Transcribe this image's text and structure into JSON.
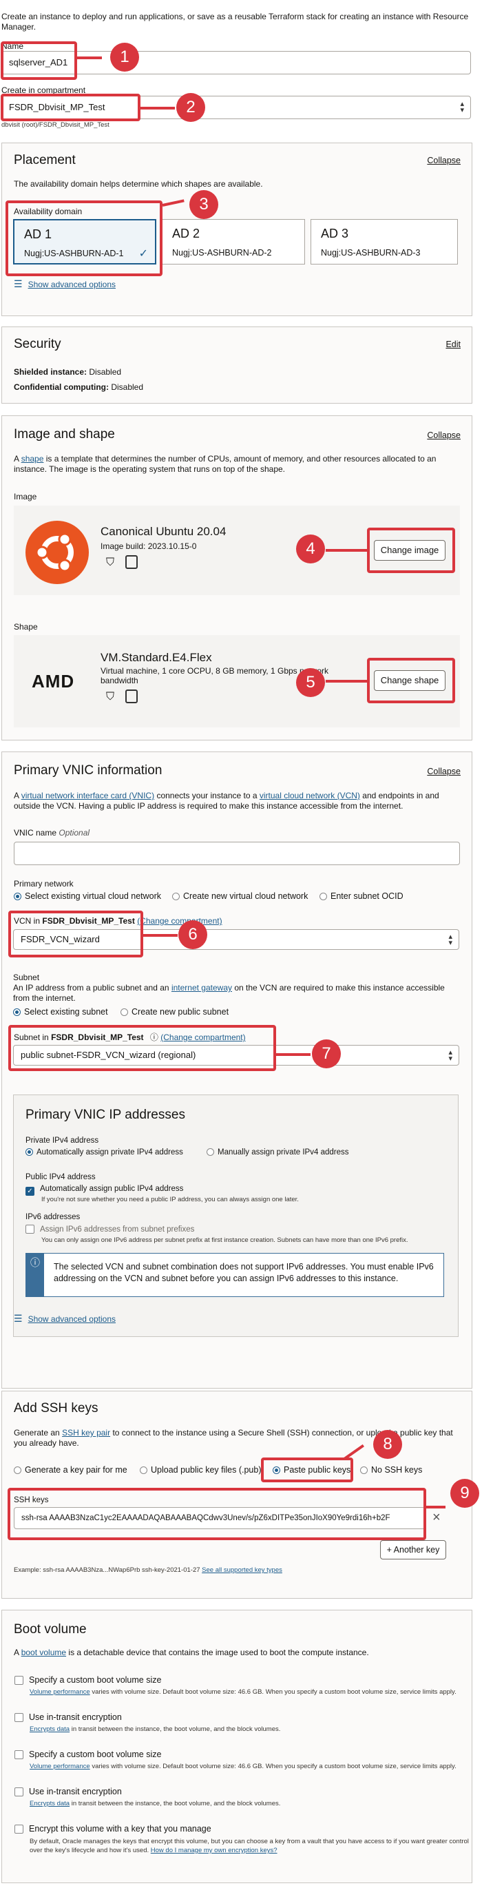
{
  "intro": "Create an instance to deploy and run applications, or save as a reusable Terraform stack for creating an instance with Resource Manager.",
  "name_field": {
    "label": "Name",
    "value": "sqlserver_AD1"
  },
  "compartment": {
    "label": "Create in compartment",
    "value": "FSDR_Dbvisit_MP_Test",
    "path": "dbvisit (root)/FSDR_Dbvisit_MP_Test"
  },
  "placement": {
    "title": "Placement",
    "collapse": "Collapse",
    "help": "The availability domain helps determine which shapes are available.",
    "ad_label": "Availability domain",
    "ads": [
      {
        "name": "AD 1",
        "sub": "Nugj:US-ASHBURN-AD-1"
      },
      {
        "name": "AD 2",
        "sub": "Nugj:US-ASHBURN-AD-2"
      },
      {
        "name": "AD 3",
        "sub": "Nugj:US-ASHBURN-AD-3"
      }
    ],
    "advanced": "Show advanced options"
  },
  "security": {
    "title": "Security",
    "edit": "Edit",
    "shielded_label": "Shielded instance:",
    "shielded_value": "Disabled",
    "confidential_label": "Confidential computing:",
    "confidential_value": "Disabled"
  },
  "image_shape": {
    "title": "Image and shape",
    "collapse": "Collapse",
    "desc_pre": "A",
    "desc_link": "shape",
    "desc_post": "is a template that determines the number of CPUs, amount of memory, and other resources allocated to an instance. The image is the operating system that runs on top of the shape.",
    "image_label": "Image",
    "image_name": "Canonical Ubuntu 20.04",
    "image_build": "Image build: 2023.10.15-0",
    "change_image": "Change image",
    "shape_label": "Shape",
    "shape_name": "VM.Standard.E4.Flex",
    "shape_desc": "Virtual machine, 1 core OCPU, 8 GB memory, 1 Gbps network bandwidth",
    "amd_logo": "AMD",
    "change_shape": "Change shape"
  },
  "vnic": {
    "title": "Primary VNIC information",
    "collapse": "Collapse",
    "desc_1": "A",
    "desc_link1": "virtual network interface card (VNIC)",
    "desc_2": "connects your instance to a",
    "desc_link2": "virtual cloud network (VCN)",
    "desc_3": "and endpoints in and outside the VCN. Having a public IP address is required to make this instance accessible from the internet.",
    "vnic_name_label": "VNIC name",
    "optional": "Optional",
    "network_label": "Primary network",
    "network_options": [
      "Select existing virtual cloud network",
      "Create new virtual cloud network",
      "Enter subnet OCID"
    ],
    "vcn_label_pre": "VCN in",
    "vcn_label_bold": "FSDR_Dbvisit_MP_Test",
    "change_compartment": "(Change compartment)",
    "vcn_value": "FSDR_VCN_wizard",
    "subnet_title": "Subnet",
    "subnet_desc_1": "An IP address from a public subnet and an",
    "subnet_desc_link": "internet gateway",
    "subnet_desc_2": "on the VCN are required to make this instance accessible from the internet.",
    "subnet_options": [
      "Select existing subnet",
      "Create new public subnet"
    ],
    "subnet_label_pre": "Subnet in",
    "subnet_label_bold": "FSDR_Dbvisit_MP_Test",
    "subnet_change": "(Change compartment)",
    "subnet_value": "public subnet-FSDR_VCN_wizard (regional)"
  },
  "ip": {
    "title": "Primary VNIC IP addresses",
    "ipv4_label": "Private IPv4 address",
    "ipv4_options": [
      "Automatically assign private IPv4 address",
      "Manually assign private IPv4 address"
    ],
    "public_label": "Public IPv4 address",
    "public_check": "Automatically assign public IPv4 address",
    "public_help": "If you're not sure whether you need a public IP address, you can always assign one later.",
    "ipv6_label": "IPv6 addresses",
    "ipv6_check": "Assign IPv6 addresses from subnet prefixes",
    "ipv6_help": "You can only assign one IPv6 address per subnet prefix at first instance creation. Subnets can have more than one IPv6 prefix.",
    "info": "The selected VCN and subnet combination does not support IPv6 addresses. You must enable IPv6 addressing on the VCN and subnet before you can assign IPv6 addresses to this instance.",
    "advanced": "Show advanced options"
  },
  "ssh": {
    "title": "Add SSH keys",
    "desc_1": "Generate an",
    "desc_link": "SSH key pair",
    "desc_2": "to connect to the instance using a Secure Shell (SSH) connection, or upload a public key that you already have.",
    "options": [
      "Generate a key pair for me",
      "Upload public key files (.pub)",
      "Paste public keys",
      "No SSH keys"
    ],
    "keys_label": "SSH keys",
    "key_value": "ssh-rsa AAAAB3NzaC1yc2EAAAADAQABAAABAQCdwv3Unev/s/pZ6xDITPe35onJIoX90Ye9rdi16h+b2F",
    "another_key": "+ Another key",
    "example": "Example: ssh-rsa AAAAB3Nza...NWap6Prb ssh-key-2021-01-27",
    "example_link": "See all supported key types"
  },
  "boot": {
    "title": "Boot volume",
    "desc_1": "A",
    "desc_link": "boot volume",
    "desc_2": "is a detachable device that contains the image used to boot the compute instance.",
    "items": [
      {
        "label": "Specify a custom boot volume size",
        "help_link": "Volume performance",
        "help": "varies with volume size. Default boot volume size: 46.6 GB. When you specify a custom boot volume size, service limits apply."
      },
      {
        "label": "Use in-transit encryption",
        "help_link": "Encrypts data",
        "help": "in transit between the instance, the boot volume, and the block volumes."
      },
      {
        "label": "Specify a custom boot volume size",
        "help_link": "Volume performance",
        "help": "varies with volume size. Default boot volume size: 46.6 GB. When you specify a custom boot volume size, service limits apply."
      },
      {
        "label": "Use in-transit encryption",
        "help_link": "Encrypts data",
        "help": "in transit between the instance, the boot volume, and the block volumes."
      },
      {
        "label": "Encrypt this volume with a key that you manage",
        "help_link": "",
        "help": "By default, Oracle manages the keys that encrypt this volume, but you can choose a key from a vault that you have access to if you want greater control over the key's lifecycle and how it's used.",
        "help_link2": "How do I manage my own encryption keys?"
      }
    ]
  },
  "badges": [
    "1",
    "2",
    "3",
    "4",
    "5",
    "6",
    "7",
    "8",
    "9"
  ],
  "colors": {
    "annotation": "#d9363e",
    "link": "#1c5c8c",
    "ubuntu": "#e95420",
    "info_bar": "#3b6e99"
  }
}
